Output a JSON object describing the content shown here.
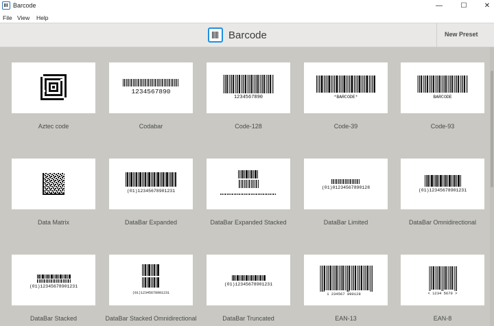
{
  "window": {
    "title": "Barcode",
    "minimize_glyph": "—",
    "maximize_glyph": "☐",
    "close_glyph": "✕"
  },
  "menu": {
    "items": [
      "File",
      "View",
      "Help"
    ]
  },
  "header": {
    "title": "Barcode",
    "new_preset_label": "New Preset",
    "accent_color": "#1e8fe0"
  },
  "tiles": [
    {
      "label": "Aztec code",
      "preview_text": ""
    },
    {
      "label": "Codabar",
      "preview_text": "1234567890"
    },
    {
      "label": "Code-128",
      "preview_text": "1234567890"
    },
    {
      "label": "Code-39",
      "preview_text": "*BARCODE*"
    },
    {
      "label": "Code-93",
      "preview_text": "BARCODE"
    },
    {
      "label": "Data Matrix",
      "preview_text": ""
    },
    {
      "label": "DataBar Expanded",
      "preview_text": "(01)12345678901231"
    },
    {
      "label": "DataBar Expanded Stacked",
      "preview_text": ""
    },
    {
      "label": "DataBar Limited",
      "preview_text": "(01)01234567890128"
    },
    {
      "label": "DataBar Omnidirectional",
      "preview_text": "(01)12345678901231"
    },
    {
      "label": "DataBar Stacked",
      "preview_text": "(01)12345678901231"
    },
    {
      "label": "DataBar Stacked Omnidirectional",
      "preview_text": "(01)12345678901231"
    },
    {
      "label": "DataBar Truncated",
      "preview_text": "(01)12345678901231"
    },
    {
      "label": "EAN-13",
      "preview_text": "1 234567 890128"
    },
    {
      "label": "EAN-8",
      "preview_text": "< 1234 5670 >"
    }
  ]
}
